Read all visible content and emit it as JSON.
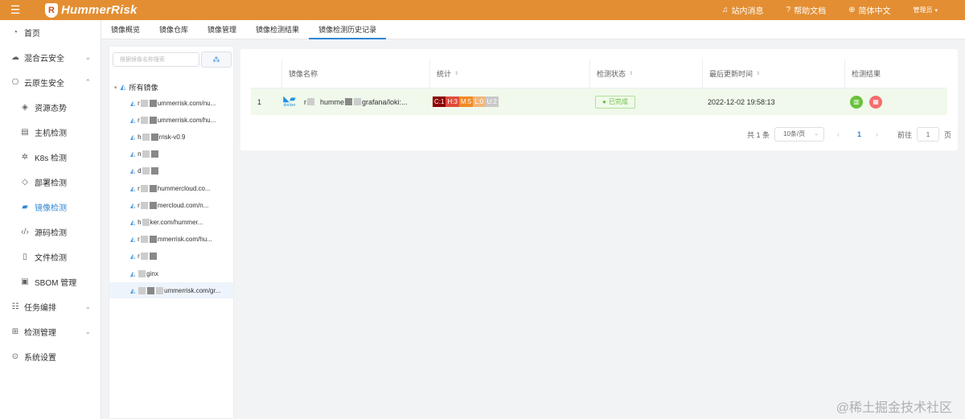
{
  "app": {
    "logo_text": "HummerRisk",
    "top_links": [
      {
        "label": "站内消息",
        "icon": "bell-icon"
      },
      {
        "label": "帮助文档",
        "icon": "help-icon"
      },
      {
        "label": "简体中文",
        "icon": "globe-icon"
      }
    ],
    "user_label": "管理员"
  },
  "sidebar": {
    "items": [
      {
        "label": "首页",
        "icon": "home-icon",
        "level": 1,
        "chevron": false
      },
      {
        "label": "混合云安全",
        "icon": "cloud-icon",
        "level": 1,
        "chevron": true
      },
      {
        "label": "云原生安全",
        "icon": "cloud-native-icon",
        "level": 1,
        "chevron": true
      },
      {
        "label": "资源态势",
        "icon": "shield-icon",
        "level": 2
      },
      {
        "label": "主机检测",
        "icon": "server-icon",
        "level": 2
      },
      {
        "label": "K8s 检测",
        "icon": "k8s-icon",
        "level": 2
      },
      {
        "label": "部署检测",
        "icon": "deploy-icon",
        "level": 2
      },
      {
        "label": "镜像检测",
        "icon": "docker-icon",
        "level": 2,
        "active": true
      },
      {
        "label": "源码检测",
        "icon": "code-icon",
        "level": 2
      },
      {
        "label": "文件检测",
        "icon": "file-icon",
        "level": 2
      },
      {
        "label": "SBOM 管理",
        "icon": "sbom-icon",
        "level": 2
      },
      {
        "label": "任务编排",
        "icon": "list-icon",
        "level": 1,
        "chevron": true
      },
      {
        "label": "检测管理",
        "icon": "grid-icon",
        "level": 1,
        "chevron": true
      },
      {
        "label": "系统设置",
        "icon": "settings-icon",
        "level": 1,
        "chevron": false
      }
    ]
  },
  "tabs": [
    {
      "label": "镜像概览"
    },
    {
      "label": "镜像仓库"
    },
    {
      "label": "镜像管理"
    },
    {
      "label": "镜像检测结果"
    },
    {
      "label": "镜像检测历史记录",
      "active": true
    }
  ],
  "tree": {
    "search_placeholder": "根据镜像名称搜索",
    "root_label": "所有镜像",
    "nodes": [
      {
        "prefix": "r",
        "blur": 2,
        "suffix": "ummerrisk.com/nu..."
      },
      {
        "prefix": "r",
        "blur": 2,
        "suffix": "ummerrisk.com/hu..."
      },
      {
        "prefix": "h",
        "blur": 2,
        "suffix": "rrisk-v0.9"
      },
      {
        "prefix": "n",
        "blur": 2,
        "suffix": ""
      },
      {
        "prefix": "d",
        "blur": 2,
        "suffix": ""
      },
      {
        "prefix": "r",
        "blur": 2,
        "suffix": "hummercloud.co..."
      },
      {
        "prefix": "r",
        "blur": 2,
        "suffix": "mercloud.com/n..."
      },
      {
        "prefix": "h",
        "blur": 1,
        "suffix": "ker.com/hummer..."
      },
      {
        "prefix": "r",
        "blur": 2,
        "suffix": "mmerrisk.com/hu..."
      },
      {
        "prefix": "r",
        "blur": 2,
        "suffix": ""
      },
      {
        "prefix": "",
        "blur": 1,
        "suffix": "ginx"
      },
      {
        "prefix": "",
        "blur": 3,
        "suffix": "ummerrisk.com/gr...",
        "selected": true
      }
    ]
  },
  "table": {
    "columns": [
      {
        "label": "镜像名称",
        "sortable": false
      },
      {
        "label": "统计",
        "sortable": true
      },
      {
        "label": "检测状态",
        "sortable": true
      },
      {
        "label": "最后更新时间",
        "sortable": true
      },
      {
        "label": "检测结果",
        "sortable": false
      }
    ],
    "rows": [
      {
        "index": "1",
        "image_name_prefix": "r",
        "image_name_mid": "humme",
        "image_name_suffix": "grafana/loki:...",
        "docker_label": "docker",
        "stats": [
          {
            "label": "C:1",
            "color": "#8b0000"
          },
          {
            "label": "H:3",
            "color": "#e04b3a"
          },
          {
            "label": "M:5",
            "color": "#f08a24"
          },
          {
            "label": "L:0",
            "color": "#f2b679"
          },
          {
            "label": "U:2",
            "color": "#c8c8c8"
          }
        ],
        "status": "已完成",
        "updated": "2022-12-02 19:58:13"
      }
    ]
  },
  "pager": {
    "total": "共 1 条",
    "page_size": "10条/页",
    "current": "1",
    "goto_label": "前往",
    "goto_value": "1",
    "page_suffix": "页"
  },
  "watermark": "@稀土掘金技术社区",
  "colors": {
    "header": "#e38e32",
    "accent": "#2f87d6",
    "success": "#67c23a",
    "danger": "#f56c6c"
  }
}
